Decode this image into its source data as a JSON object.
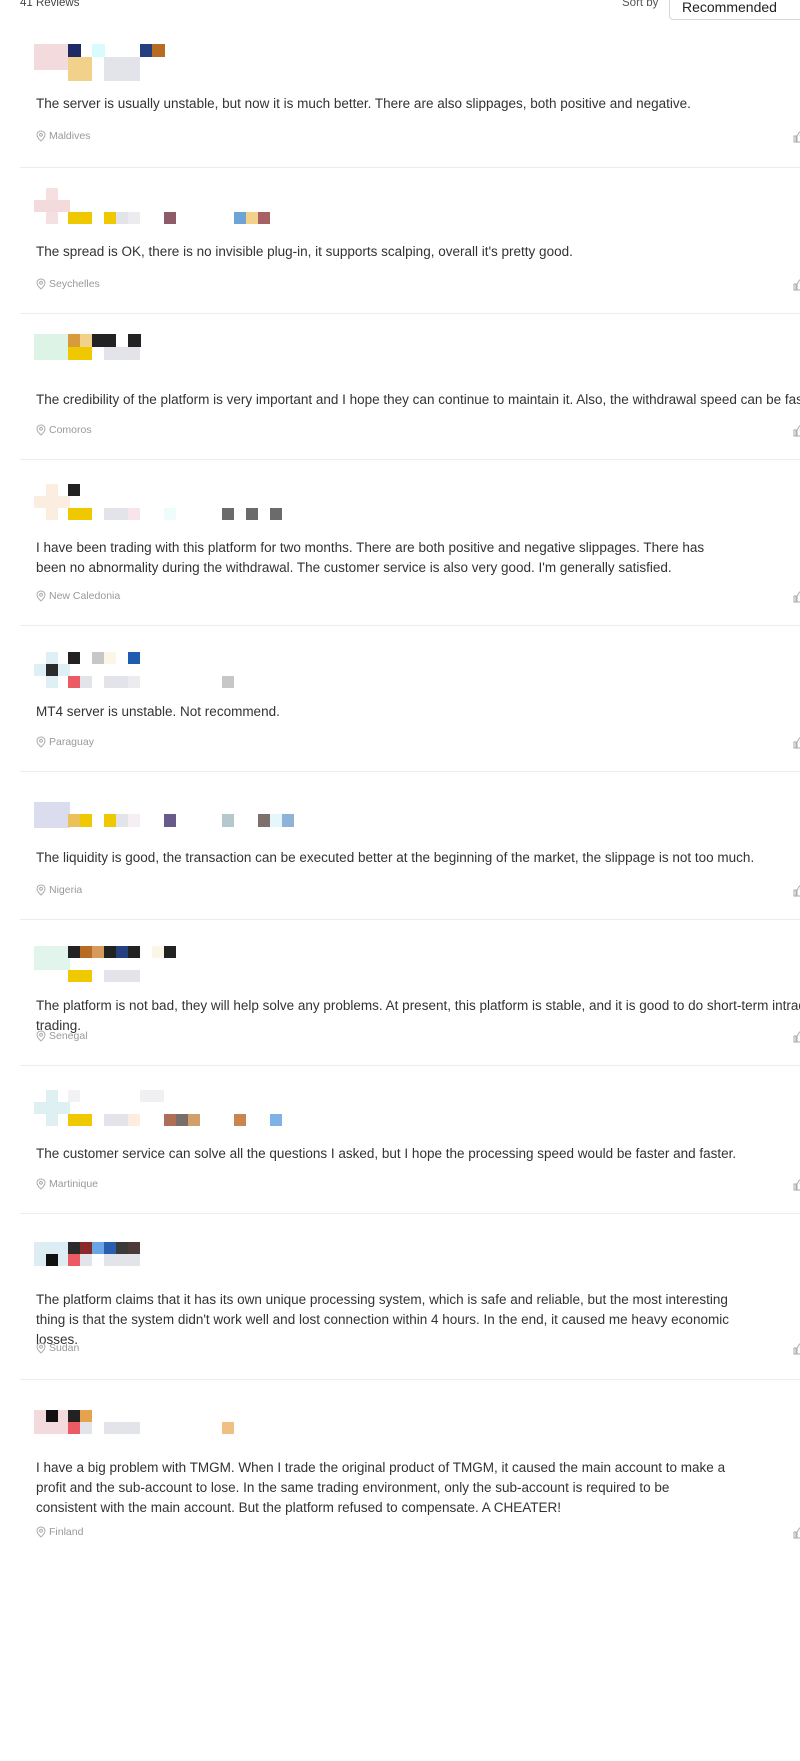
{
  "header": {
    "review_count": "41 Reviews",
    "sort_label": "Sort by",
    "sort_value": "Recommended"
  },
  "reviews": [
    {
      "text": "The server is usually unstable, but now it is much better. There are also slippages, both positive and negative.",
      "location": "Maldives"
    },
    {
      "text": "The spread is OK, there is no invisible plug-in, it supports scalping, overall it's pretty good.",
      "location": "Seychelles"
    },
    {
      "text": "The credibility of the platform is very important and I hope they can continue to maintain it. Also, the withdrawal speed can be faster.",
      "location": "Comoros"
    },
    {
      "text": "I have been trading with this platform for two months. There are both positive and negative slippages. There has been no abnormality during the withdrawal. The customer service is also very good. I'm generally satisfied.",
      "location": "New Caledonia"
    },
    {
      "text": "MT4 server is unstable. Not recommend.",
      "location": "Paraguay"
    },
    {
      "text": "The liquidity is good, the transaction can be executed better at the beginning of the market, the slippage is not too much.",
      "location": "Nigeria"
    },
    {
      "text": "The platform is not bad, they will help solve any problems. At present, this platform is stable, and it is good to do short-term intraday trading.",
      "location": "Senegal"
    },
    {
      "text": "The customer service can solve all the questions I asked, but I hope the processing speed would be faster and faster.",
      "location": "Martinique"
    },
    {
      "text": "The platform claims that it has its own unique processing system, which is safe and reliable, but the most interesting thing is that the system didn't work well and lost connection within 4 hours. In the end, it caused me heavy economic losses.",
      "location": "Sudan"
    },
    {
      "text": "I have a big problem with TMGM. When I trade the original product of TMGM, it caused the main account to make a profit and the sub-account to lose. In the same trading environment, only the sub-account is required to be consistent with the main account. But the platform refused to compensate. A CHEATER!",
      "location": "Finland"
    }
  ],
  "icons": {
    "location": "location-pin-icon",
    "like": "thumbs-up-icon"
  },
  "colors": {
    "accent_yellow": "#f0c800",
    "divider": "#ececec",
    "meta_text": "#999999"
  }
}
